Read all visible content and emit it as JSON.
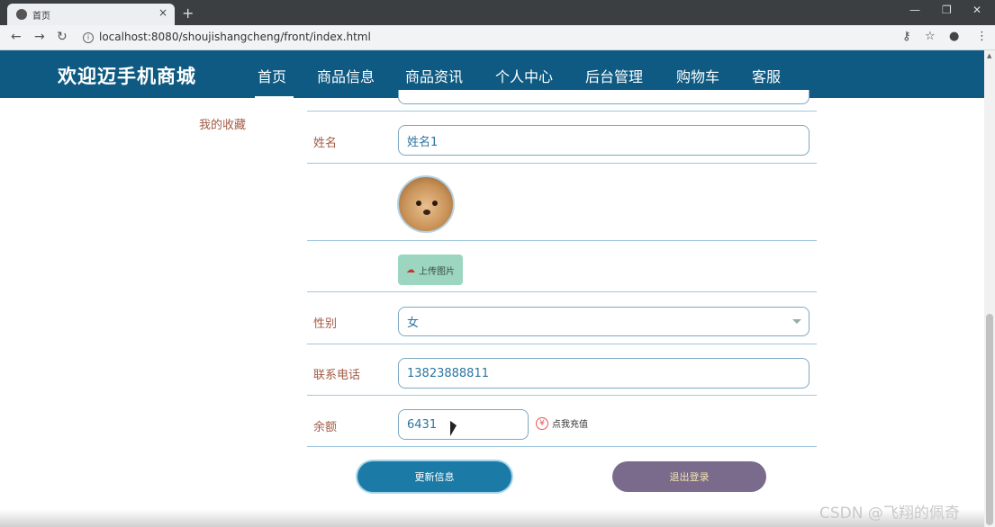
{
  "browser": {
    "tab_title": "首页",
    "tab_close": "×",
    "new_tab": "+",
    "url": "localhost:8080/shoujishangcheng/front/index.html",
    "win_min": "—",
    "win_restore": "❐",
    "win_close": "✕"
  },
  "site": {
    "brand": "欢迎迈手机商城",
    "nav": [
      "首页",
      "商品信息",
      "商品资讯",
      "个人中心",
      "后台管理",
      "购物车",
      "客服"
    ]
  },
  "sidebar": {
    "favorites": "我的收藏"
  },
  "form": {
    "name_label": "姓名",
    "name_value": "姓名1",
    "upload_label": "上传图片",
    "gender_label": "性别",
    "gender_value": "女",
    "phone_label": "联系电话",
    "phone_value": "13823888811",
    "balance_label": "余额",
    "balance_value": "6431",
    "recharge_label": "点我充值"
  },
  "actions": {
    "update": "更新信息",
    "logout": "退出登录"
  },
  "watermark": "CSDN @飞翔的佩奇"
}
